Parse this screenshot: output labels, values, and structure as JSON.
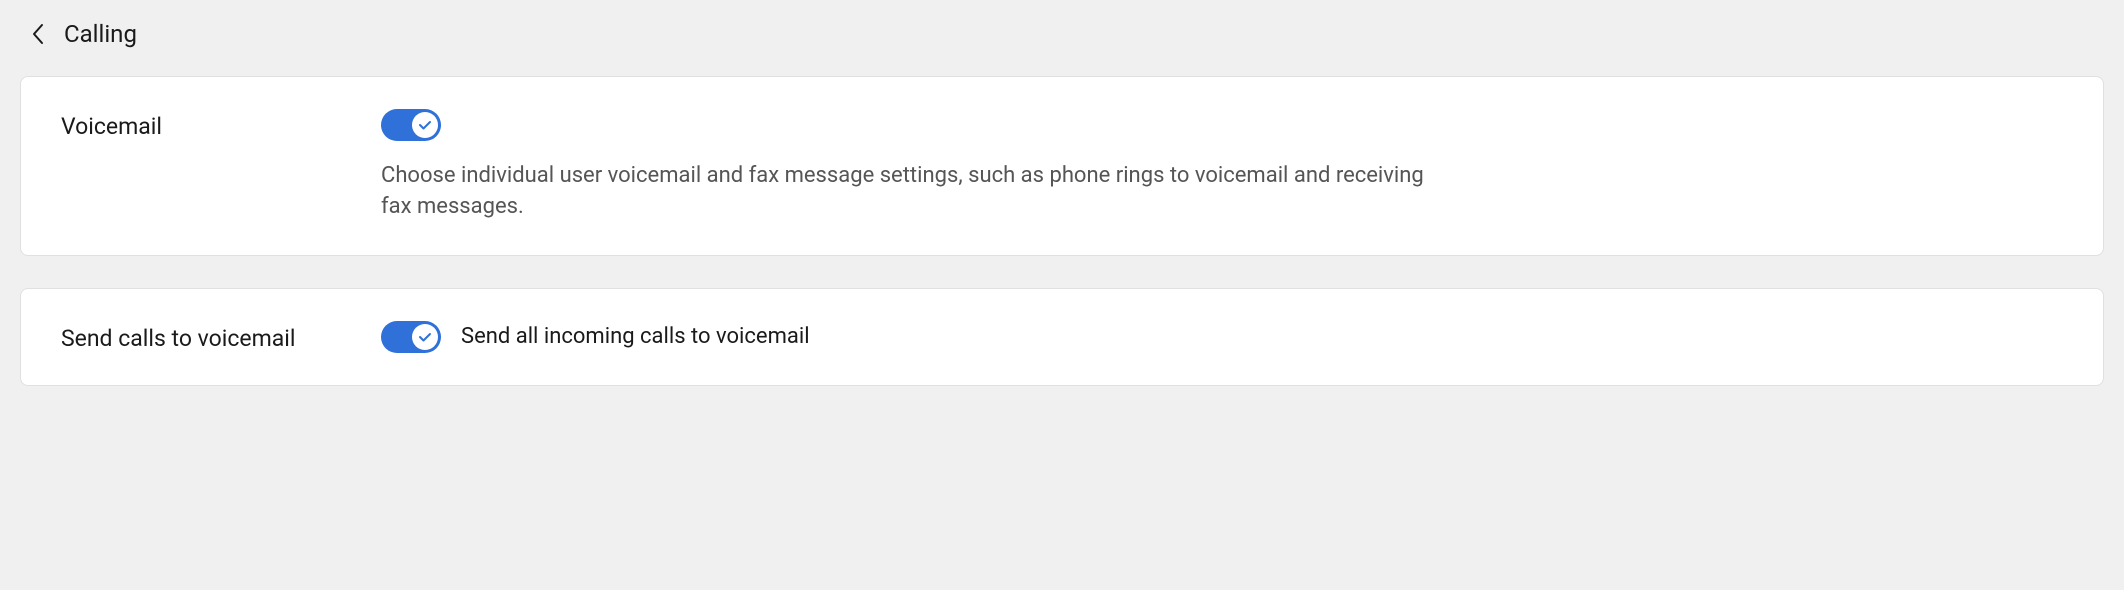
{
  "header": {
    "title": "Calling"
  },
  "settings": {
    "voicemail": {
      "label": "Voicemail",
      "enabled": true,
      "description": "Choose individual user voicemail and fax message settings, such as phone rings to voicemail and receiving fax messages."
    },
    "sendCallsToVoicemail": {
      "label": "Send calls to voicemail",
      "enabled": true,
      "inlineLabel": "Send all incoming calls to voicemail"
    }
  },
  "colors": {
    "toggleActive": "#2f71d9",
    "background": "#f0f0f0",
    "cardBackground": "#ffffff"
  }
}
